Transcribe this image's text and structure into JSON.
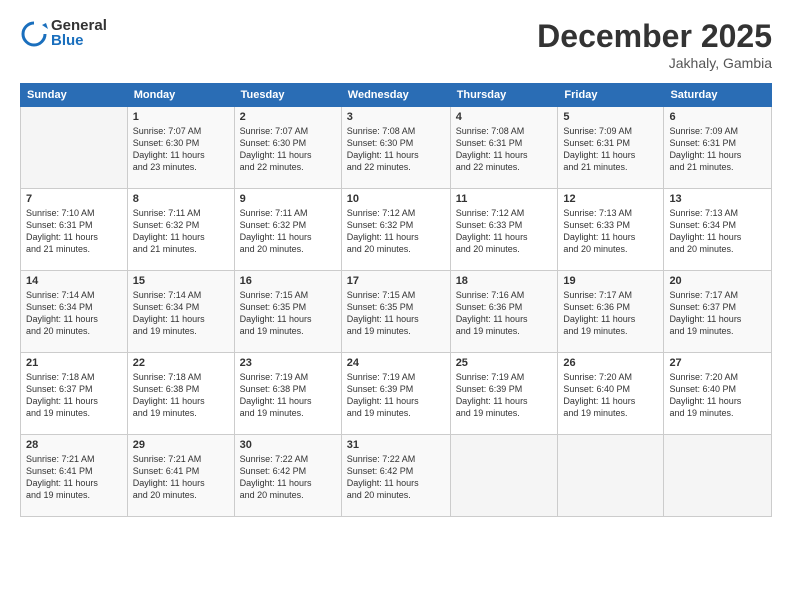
{
  "logo": {
    "general": "General",
    "blue": "Blue"
  },
  "header": {
    "month": "December 2025",
    "location": "Jakhaly, Gambia"
  },
  "days_header": [
    "Sunday",
    "Monday",
    "Tuesday",
    "Wednesday",
    "Thursday",
    "Friday",
    "Saturday"
  ],
  "weeks": [
    [
      {
        "num": "",
        "info": ""
      },
      {
        "num": "1",
        "info": "Sunrise: 7:07 AM\nSunset: 6:30 PM\nDaylight: 11 hours\nand 23 minutes."
      },
      {
        "num": "2",
        "info": "Sunrise: 7:07 AM\nSunset: 6:30 PM\nDaylight: 11 hours\nand 22 minutes."
      },
      {
        "num": "3",
        "info": "Sunrise: 7:08 AM\nSunset: 6:30 PM\nDaylight: 11 hours\nand 22 minutes."
      },
      {
        "num": "4",
        "info": "Sunrise: 7:08 AM\nSunset: 6:31 PM\nDaylight: 11 hours\nand 22 minutes."
      },
      {
        "num": "5",
        "info": "Sunrise: 7:09 AM\nSunset: 6:31 PM\nDaylight: 11 hours\nand 21 minutes."
      },
      {
        "num": "6",
        "info": "Sunrise: 7:09 AM\nSunset: 6:31 PM\nDaylight: 11 hours\nand 21 minutes."
      }
    ],
    [
      {
        "num": "7",
        "info": "Sunrise: 7:10 AM\nSunset: 6:31 PM\nDaylight: 11 hours\nand 21 minutes."
      },
      {
        "num": "8",
        "info": "Sunrise: 7:11 AM\nSunset: 6:32 PM\nDaylight: 11 hours\nand 21 minutes."
      },
      {
        "num": "9",
        "info": "Sunrise: 7:11 AM\nSunset: 6:32 PM\nDaylight: 11 hours\nand 20 minutes."
      },
      {
        "num": "10",
        "info": "Sunrise: 7:12 AM\nSunset: 6:32 PM\nDaylight: 11 hours\nand 20 minutes."
      },
      {
        "num": "11",
        "info": "Sunrise: 7:12 AM\nSunset: 6:33 PM\nDaylight: 11 hours\nand 20 minutes."
      },
      {
        "num": "12",
        "info": "Sunrise: 7:13 AM\nSunset: 6:33 PM\nDaylight: 11 hours\nand 20 minutes."
      },
      {
        "num": "13",
        "info": "Sunrise: 7:13 AM\nSunset: 6:34 PM\nDaylight: 11 hours\nand 20 minutes."
      }
    ],
    [
      {
        "num": "14",
        "info": "Sunrise: 7:14 AM\nSunset: 6:34 PM\nDaylight: 11 hours\nand 20 minutes."
      },
      {
        "num": "15",
        "info": "Sunrise: 7:14 AM\nSunset: 6:34 PM\nDaylight: 11 hours\nand 19 minutes."
      },
      {
        "num": "16",
        "info": "Sunrise: 7:15 AM\nSunset: 6:35 PM\nDaylight: 11 hours\nand 19 minutes."
      },
      {
        "num": "17",
        "info": "Sunrise: 7:15 AM\nSunset: 6:35 PM\nDaylight: 11 hours\nand 19 minutes."
      },
      {
        "num": "18",
        "info": "Sunrise: 7:16 AM\nSunset: 6:36 PM\nDaylight: 11 hours\nand 19 minutes."
      },
      {
        "num": "19",
        "info": "Sunrise: 7:17 AM\nSunset: 6:36 PM\nDaylight: 11 hours\nand 19 minutes."
      },
      {
        "num": "20",
        "info": "Sunrise: 7:17 AM\nSunset: 6:37 PM\nDaylight: 11 hours\nand 19 minutes."
      }
    ],
    [
      {
        "num": "21",
        "info": "Sunrise: 7:18 AM\nSunset: 6:37 PM\nDaylight: 11 hours\nand 19 minutes."
      },
      {
        "num": "22",
        "info": "Sunrise: 7:18 AM\nSunset: 6:38 PM\nDaylight: 11 hours\nand 19 minutes."
      },
      {
        "num": "23",
        "info": "Sunrise: 7:19 AM\nSunset: 6:38 PM\nDaylight: 11 hours\nand 19 minutes."
      },
      {
        "num": "24",
        "info": "Sunrise: 7:19 AM\nSunset: 6:39 PM\nDaylight: 11 hours\nand 19 minutes."
      },
      {
        "num": "25",
        "info": "Sunrise: 7:19 AM\nSunset: 6:39 PM\nDaylight: 11 hours\nand 19 minutes."
      },
      {
        "num": "26",
        "info": "Sunrise: 7:20 AM\nSunset: 6:40 PM\nDaylight: 11 hours\nand 19 minutes."
      },
      {
        "num": "27",
        "info": "Sunrise: 7:20 AM\nSunset: 6:40 PM\nDaylight: 11 hours\nand 19 minutes."
      }
    ],
    [
      {
        "num": "28",
        "info": "Sunrise: 7:21 AM\nSunset: 6:41 PM\nDaylight: 11 hours\nand 19 minutes."
      },
      {
        "num": "29",
        "info": "Sunrise: 7:21 AM\nSunset: 6:41 PM\nDaylight: 11 hours\nand 20 minutes."
      },
      {
        "num": "30",
        "info": "Sunrise: 7:22 AM\nSunset: 6:42 PM\nDaylight: 11 hours\nand 20 minutes."
      },
      {
        "num": "31",
        "info": "Sunrise: 7:22 AM\nSunset: 6:42 PM\nDaylight: 11 hours\nand 20 minutes."
      },
      {
        "num": "",
        "info": ""
      },
      {
        "num": "",
        "info": ""
      },
      {
        "num": "",
        "info": ""
      }
    ]
  ]
}
